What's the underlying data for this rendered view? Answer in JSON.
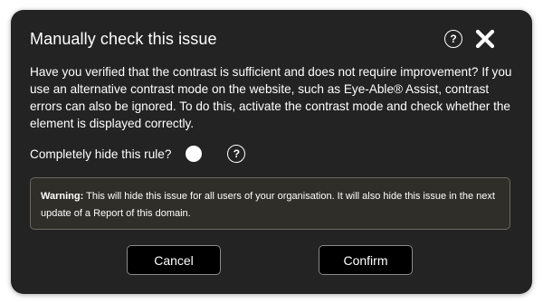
{
  "dialog": {
    "title": "Manually check this issue",
    "help_icon": "question-circle-icon",
    "close_icon": "close-x-icon",
    "description": "Have you verified that the contrast is sufficient and does not require improvement? If you use an alternative contrast mode on the website, such as Eye-Able® Assist, contrast errors can also be ignored. To do this, activate the contrast mode and check whether the element is displayed correctly.",
    "hide_rule_label": "Completely hide this rule?",
    "hide_rule_enabled": false,
    "help_glyph": "?",
    "warning": {
      "label": "Warning:",
      "text": " This will hide this issue for all users of your organisation. It will also hide this issue in the next update of a Report of this domain."
    },
    "buttons": {
      "cancel": "Cancel",
      "confirm": "Confirm"
    }
  },
  "colors": {
    "dialog_background": "#232323",
    "warning_background": "#302e29",
    "button_background": "#000000",
    "text": "#ffffff"
  }
}
